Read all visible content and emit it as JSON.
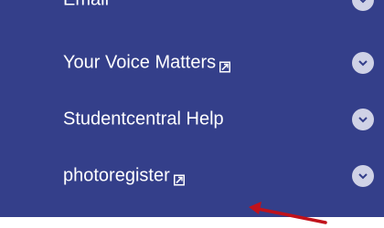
{
  "menu": {
    "items": [
      {
        "label": "Email",
        "external": false
      },
      {
        "label": "Your Voice Matters",
        "external": true
      },
      {
        "label": "Studentcentral Help",
        "external": false
      },
      {
        "label": "photoregister",
        "external": true
      }
    ]
  },
  "colors": {
    "panel_bg": "#343f8a",
    "text": "#ffffff",
    "chevron_bg": "#cfd2e6",
    "annotation_arrow": "#c0121b"
  },
  "icons": {
    "external_link": "external-link-icon",
    "expand": "chevron-down-icon"
  }
}
